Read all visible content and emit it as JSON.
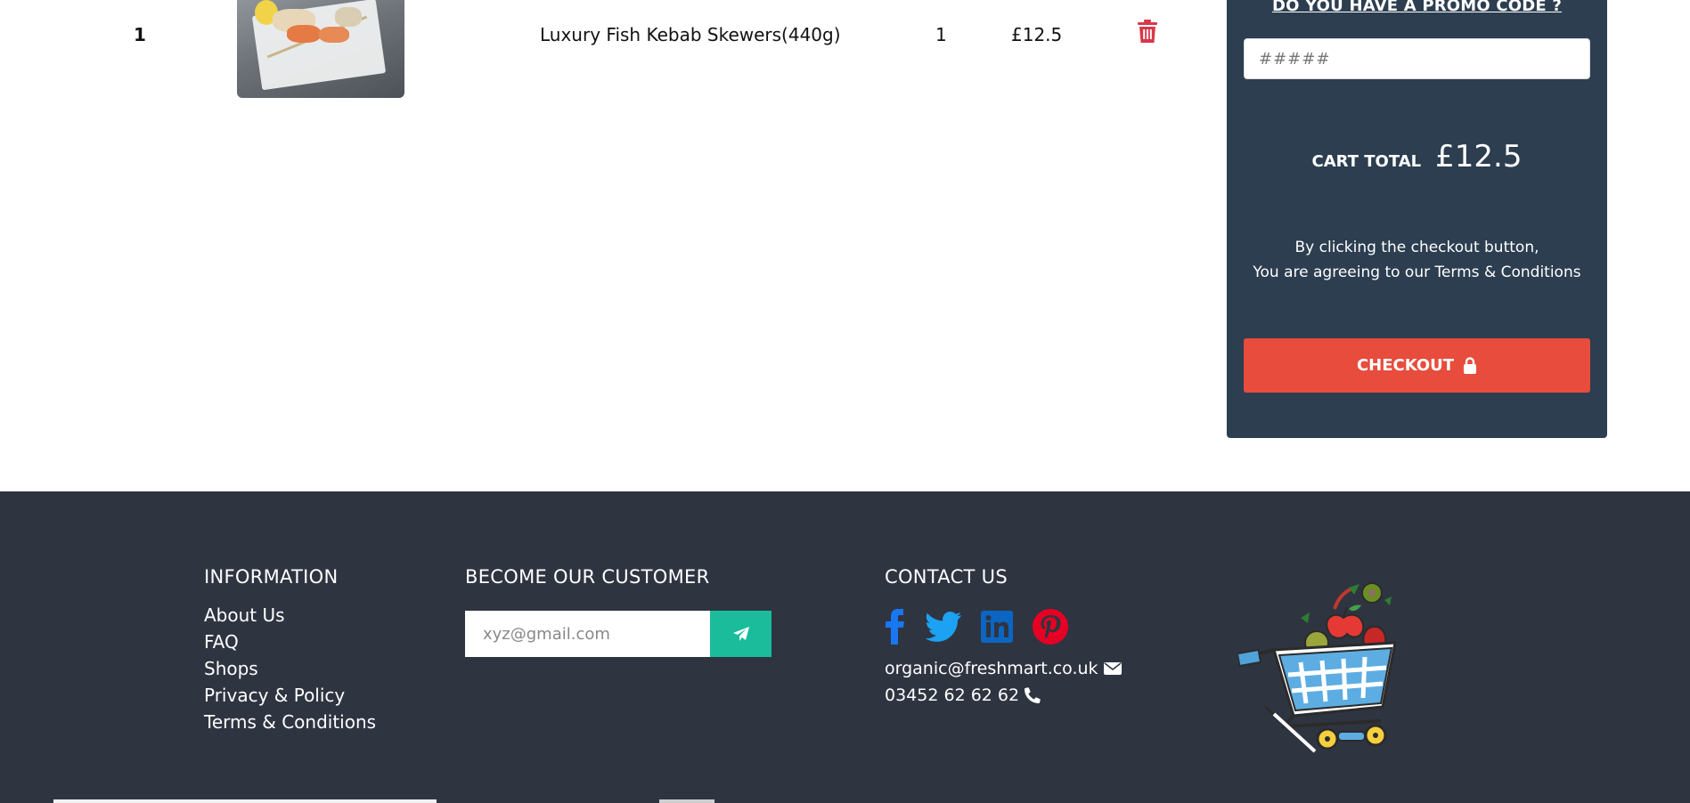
{
  "cart": {
    "item": {
      "index": "1",
      "image_alt": "Luxury Fish Kebab Skewers",
      "name": "Luxury Fish Kebab Skewers(440g)",
      "quantity": "1",
      "price": "£12.5",
      "delete_icon": "trash-icon"
    }
  },
  "summary": {
    "promo_title": "DO YOU HAVE A PROMO CODE ?",
    "promo_placeholder": "#####",
    "total_label": "CART TOTAL",
    "total_value": "£12.5",
    "terms_line1": "By clicking the checkout button,",
    "terms_line2": "You are agreeing to our Terms & Conditions",
    "checkout_label": "CHECKOUT",
    "checkout_icon": "lock-icon"
  },
  "footer": {
    "information": {
      "title": "INFORMATION",
      "links": [
        "About Us",
        "FAQ",
        "Shops",
        "Privacy & Policy",
        "Terms & Conditions"
      ]
    },
    "subscribe": {
      "title": "BECOME OUR CUSTOMER",
      "placeholder": "xyz@gmail.com",
      "button_icon": "paper-plane-icon"
    },
    "contact": {
      "title": "CONTACT US",
      "social_icons": [
        "facebook-icon",
        "twitter-icon",
        "linkedin-icon",
        "pinterest-icon"
      ],
      "email": "organic@freshmart.co.uk",
      "phone": "03452 62 62 62"
    },
    "logo_icon": "shopping-cart-produce-logo"
  },
  "colors": {
    "summary_bg": "#2c3e50",
    "checkout": "#e74c3c",
    "footer_bg": "#2f3441",
    "subscribe_button": "#1abc9c",
    "trash": "#d9384a",
    "facebook": "#1877f2",
    "twitter": "#1da1f2",
    "linkedin": "#0a66c2",
    "pinterest": "#e60023"
  }
}
